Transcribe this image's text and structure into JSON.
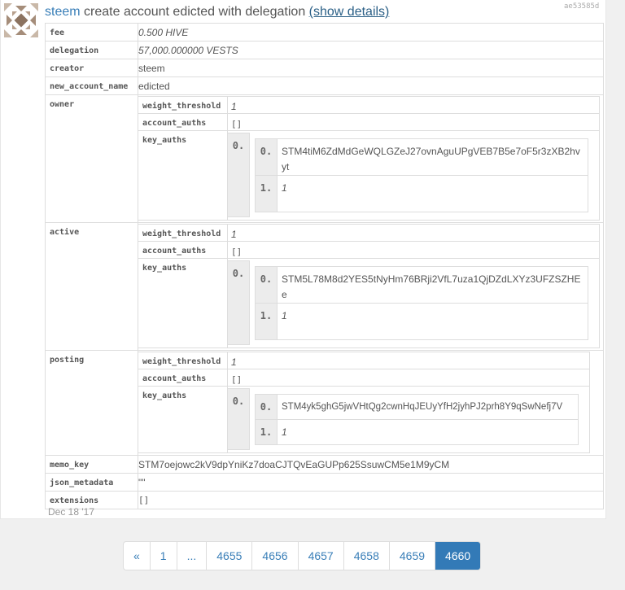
{
  "op": {
    "author": "steem",
    "summary": "create account edicted with delegation",
    "show_details": "(show details)",
    "trx_id": "ae53585d",
    "date": "Dec 18 '17"
  },
  "fields": {
    "fee": {
      "key": "fee",
      "value": "0.500 HIVE"
    },
    "delegation": {
      "key": "delegation",
      "value": "57,000.000000 VESTS"
    },
    "creator": {
      "key": "creator",
      "value": "steem"
    },
    "new_account_name": {
      "key": "new_account_name",
      "value": "edicted"
    },
    "owner": {
      "key": "owner",
      "weight_threshold_key": "weight_threshold",
      "weight_threshold": "1",
      "account_auths_key": "account_auths",
      "account_auths": "[]",
      "key_auths_key": "key_auths",
      "outer_index": "0.",
      "entry_index_0": "0.",
      "entry_key": "STM4tiM6ZdMdGeWQLGZeJ27ovnAguUPgVEB7B5e7oF5r3zXB2hvyt",
      "entry_index_1": "1.",
      "entry_weight": "1"
    },
    "active": {
      "key": "active",
      "weight_threshold_key": "weight_threshold",
      "weight_threshold": "1",
      "account_auths_key": "account_auths",
      "account_auths": "[]",
      "key_auths_key": "key_auths",
      "outer_index": "0.",
      "entry_index_0": "0.",
      "entry_key": "STM5L78M8d2YES5tNyHm76BRji2VfL7uza1QjDZdLXYz3UFZSZHEe",
      "entry_index_1": "1.",
      "entry_weight": "1"
    },
    "posting": {
      "key": "posting",
      "weight_threshold_key": "weight_threshold",
      "weight_threshold": "1",
      "account_auths_key": "account_auths",
      "account_auths": "[]",
      "key_auths_key": "key_auths",
      "outer_index": "0.",
      "entry_index_0": "0.",
      "entry_key": "STM4yk5ghG5jwVHtQg2cwnHqJEUyYfH2jyhPJ2prh8Y9qSwNefj7V",
      "entry_index_1": "1.",
      "entry_weight": "1"
    },
    "memo_key": {
      "key": "memo_key",
      "value": "STM7oejowc2kV9dpYniKz7doaCJTQvEaGUPp625SsuwCM5e1M9yCM"
    },
    "json_metadata": {
      "key": "json_metadata",
      "value": "\"\""
    },
    "extensions": {
      "key": "extensions",
      "value": "[]"
    }
  },
  "pagination": [
    "«",
    "1",
    "...",
    "4655",
    "4656",
    "4657",
    "4658",
    "4659",
    "4660"
  ],
  "pagination_active": "4660",
  "colors": {
    "link": "#3a7fb8",
    "active_page": "#337ab7",
    "index_bg": "#ececec"
  }
}
